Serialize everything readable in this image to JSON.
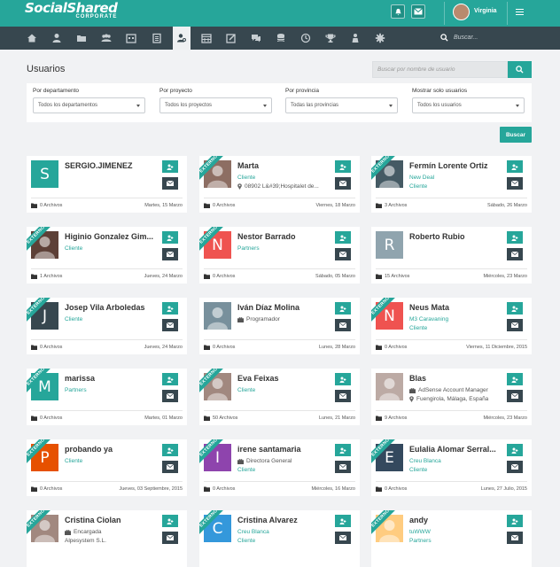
{
  "app": {
    "logo_main": "SocialShared",
    "logo_sub": "CORPORATE",
    "user_name": "Virginia",
    "nav_search_placeholder": "Buscar..."
  },
  "colors": {
    "accent": "#26a69a",
    "dark": "#37474f"
  },
  "nav_icons": [
    "home-icon",
    "user-icon",
    "folder-icon",
    "group-icon",
    "calendar-grid-icon",
    "clipboard-icon",
    "user-search-icon",
    "calendar-icon",
    "edit-icon",
    "chat-icon",
    "database-icon",
    "clock-icon",
    "trophy-icon",
    "person-icon",
    "gear-icon"
  ],
  "page": {
    "title": "Usuarios",
    "search_placeholder": "Buscar por nombre de usuario",
    "filter_button": "Buscar"
  },
  "filters": [
    {
      "label": "Por departamento",
      "value": "Todos los departamentos"
    },
    {
      "label": "Por proyecto",
      "value": "Todos los proyectos"
    },
    {
      "label": "Por provincia",
      "value": "Todas las provincias"
    },
    {
      "label": "Mostrar solo usuarios",
      "value": "Todos los usuarios"
    }
  ],
  "ribbon_label": "EXTERNO",
  "users": [
    {
      "name": "SERGIO.JIMENEZ",
      "avatar_letter": "S",
      "avatar_color": "#26a69a",
      "external": false,
      "lines": [],
      "files": "0 Archivos",
      "date": "Martes, 15 Marzo"
    },
    {
      "name": "Marta",
      "avatar_letter": "",
      "avatar_color": "#8d6e63",
      "external": true,
      "lines": [
        {
          "text": "Cliente",
          "teal": true
        },
        {
          "text": "08902 L&#39;Hospitalet de...",
          "icon": "pin"
        }
      ],
      "files": "0 Archivos",
      "date": "Viernes, 18 Marzo"
    },
    {
      "name": "Fermín Lorente Ortiz",
      "avatar_letter": "",
      "avatar_color": "#455a64",
      "external": true,
      "lines": [
        {
          "text": "New Deal",
          "teal": true
        },
        {
          "text": "Cliente",
          "teal": true
        }
      ],
      "files": "3 Archivos",
      "date": "Sábado, 26 Marzo"
    },
    {
      "name": "Higinio Gonzalez Gim...",
      "avatar_letter": "",
      "avatar_color": "#5d4037",
      "external": true,
      "lines": [
        {
          "text": "Cliente",
          "teal": true
        }
      ],
      "files": "1 Archivos",
      "date": "Jueves, 24 Marzo"
    },
    {
      "name": "Nestor Barrado",
      "avatar_letter": "N",
      "avatar_color": "#ef5350",
      "external": true,
      "lines": [
        {
          "text": "Partners",
          "teal": true
        }
      ],
      "files": "0 Archivos",
      "date": "Sábado, 05 Marzo"
    },
    {
      "name": "Roberto Rubio",
      "avatar_letter": "R",
      "avatar_color": "#90a4ae",
      "external": false,
      "lines": [],
      "files": "15 Archivos",
      "date": "Miércoles, 23 Marzo"
    },
    {
      "name": "Josep Vila Arboledas",
      "avatar_letter": "J",
      "avatar_color": "#37474f",
      "external": true,
      "lines": [
        {
          "text": "Cliente",
          "teal": true
        }
      ],
      "files": "0 Archivos",
      "date": "Jueves, 24 Marzo"
    },
    {
      "name": "Iván Díaz Molina",
      "avatar_letter": "",
      "avatar_color": "#78909c",
      "external": false,
      "lines": [
        {
          "text": "Programador",
          "icon": "briefcase"
        }
      ],
      "files": "0 Archivos",
      "date": "Lunes, 28 Marzo"
    },
    {
      "name": "Neus Mata",
      "avatar_letter": "N",
      "avatar_color": "#ef5350",
      "external": true,
      "lines": [
        {
          "text": "M3 Caravaning",
          "teal": true
        },
        {
          "text": "Cliente",
          "teal": true
        }
      ],
      "files": "0 Archivos",
      "date": "Viernes, 11 Diciembre, 2015"
    },
    {
      "name": "marissa",
      "avatar_letter": "M",
      "avatar_color": "#26a69a",
      "external": true,
      "lines": [
        {
          "text": "Partners",
          "teal": true
        }
      ],
      "files": "0 Archivos",
      "date": "Martes, 01 Marzo"
    },
    {
      "name": "Eva Feixas",
      "avatar_letter": "",
      "avatar_color": "#a1887f",
      "external": true,
      "lines": [
        {
          "text": "Cliente",
          "teal": true
        }
      ],
      "files": "50 Archivos",
      "date": "Lunes, 21 Marzo"
    },
    {
      "name": "Blas",
      "avatar_letter": "",
      "avatar_color": "#bcaaa4",
      "external": false,
      "lines": [
        {
          "text": "AdSense Account Manager",
          "icon": "briefcase"
        },
        {
          "text": "Fuengirola, Málaga, España",
          "icon": "pin"
        }
      ],
      "files": "9 Archivos",
      "date": "Miércoles, 23 Marzo"
    },
    {
      "name": "probando ya",
      "avatar_letter": "P",
      "avatar_color": "#e65100",
      "external": true,
      "lines": [
        {
          "text": "Cliente",
          "teal": true
        }
      ],
      "files": "0 Archivos",
      "date": "Jueves, 03 Septiembre, 2015"
    },
    {
      "name": "irene santamaria",
      "avatar_letter": "I",
      "avatar_color": "#8e44ad",
      "external": true,
      "lines": [
        {
          "text": "Directora General",
          "icon": "briefcase"
        },
        {
          "text": "Cliente",
          "teal": true
        }
      ],
      "files": "0 Archivos",
      "date": "Miércoles, 16 Marzo"
    },
    {
      "name": "Eulalia Alomar Serral...",
      "avatar_letter": "E",
      "avatar_color": "#34495e",
      "external": true,
      "lines": [
        {
          "text": "Creu Blanca",
          "teal": true
        },
        {
          "text": "Cliente",
          "teal": true
        }
      ],
      "files": "0 Archivos",
      "date": "Lunes, 27 Julio, 2015"
    },
    {
      "name": "Cristina Ciolan",
      "avatar_letter": "",
      "avatar_color": "#a1887f",
      "external": true,
      "lines": [
        {
          "text": "Encargada",
          "icon": "briefcase"
        },
        {
          "text": "Alpesystem S.L."
        }
      ],
      "files": "",
      "date": ""
    },
    {
      "name": "Cristina Alvarez",
      "avatar_letter": "C",
      "avatar_color": "#3498db",
      "external": true,
      "lines": [
        {
          "text": "Creu Blanca",
          "teal": true
        },
        {
          "text": "Cliente",
          "teal": true
        }
      ],
      "files": "",
      "date": ""
    },
    {
      "name": "andy",
      "avatar_letter": "",
      "avatar_color": "#ffcc80",
      "external": true,
      "lines": [
        {
          "text": "tuWWW",
          "teal": true
        },
        {
          "text": "Partners",
          "teal": true
        }
      ],
      "files": "",
      "date": ""
    }
  ]
}
